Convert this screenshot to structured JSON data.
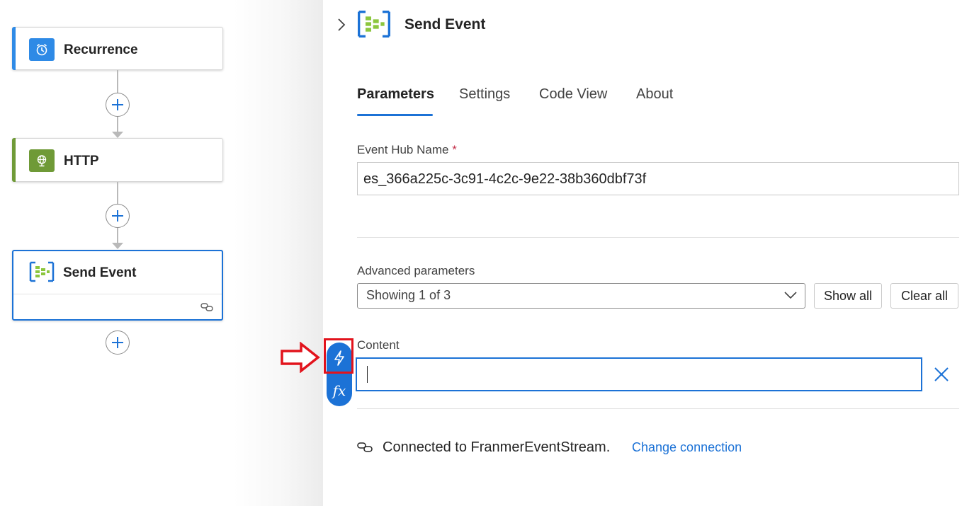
{
  "canvas": {
    "nodes": [
      {
        "title": "Recurrence",
        "icon": "clock-icon",
        "accent": "#2e8ae6"
      },
      {
        "title": "HTTP",
        "icon": "globe-icon",
        "accent": "#6f9a37"
      },
      {
        "title": "Send Event",
        "icon": "eventstream-icon",
        "accent": "#1c72d6"
      }
    ]
  },
  "panel": {
    "title": "Send Event",
    "tabs": [
      {
        "label": "Parameters",
        "active": true
      },
      {
        "label": "Settings"
      },
      {
        "label": "Code View"
      },
      {
        "label": "About"
      }
    ],
    "event_hub": {
      "label": "Event Hub Name",
      "required_mark": "*",
      "value": "es_366a225c-3c91-4c2c-9e22-38b360dbf73f"
    },
    "advanced": {
      "label": "Advanced parameters",
      "selected": "Showing 1 of 3",
      "show_all": "Show all",
      "clear_all": "Clear all"
    },
    "content": {
      "label": "Content",
      "value": ""
    },
    "connection": {
      "text": "Connected to FranmerEventStream.",
      "change": "Change connection"
    }
  },
  "colors": {
    "accent": "#1c72d6",
    "highlight": "#e2131c"
  }
}
